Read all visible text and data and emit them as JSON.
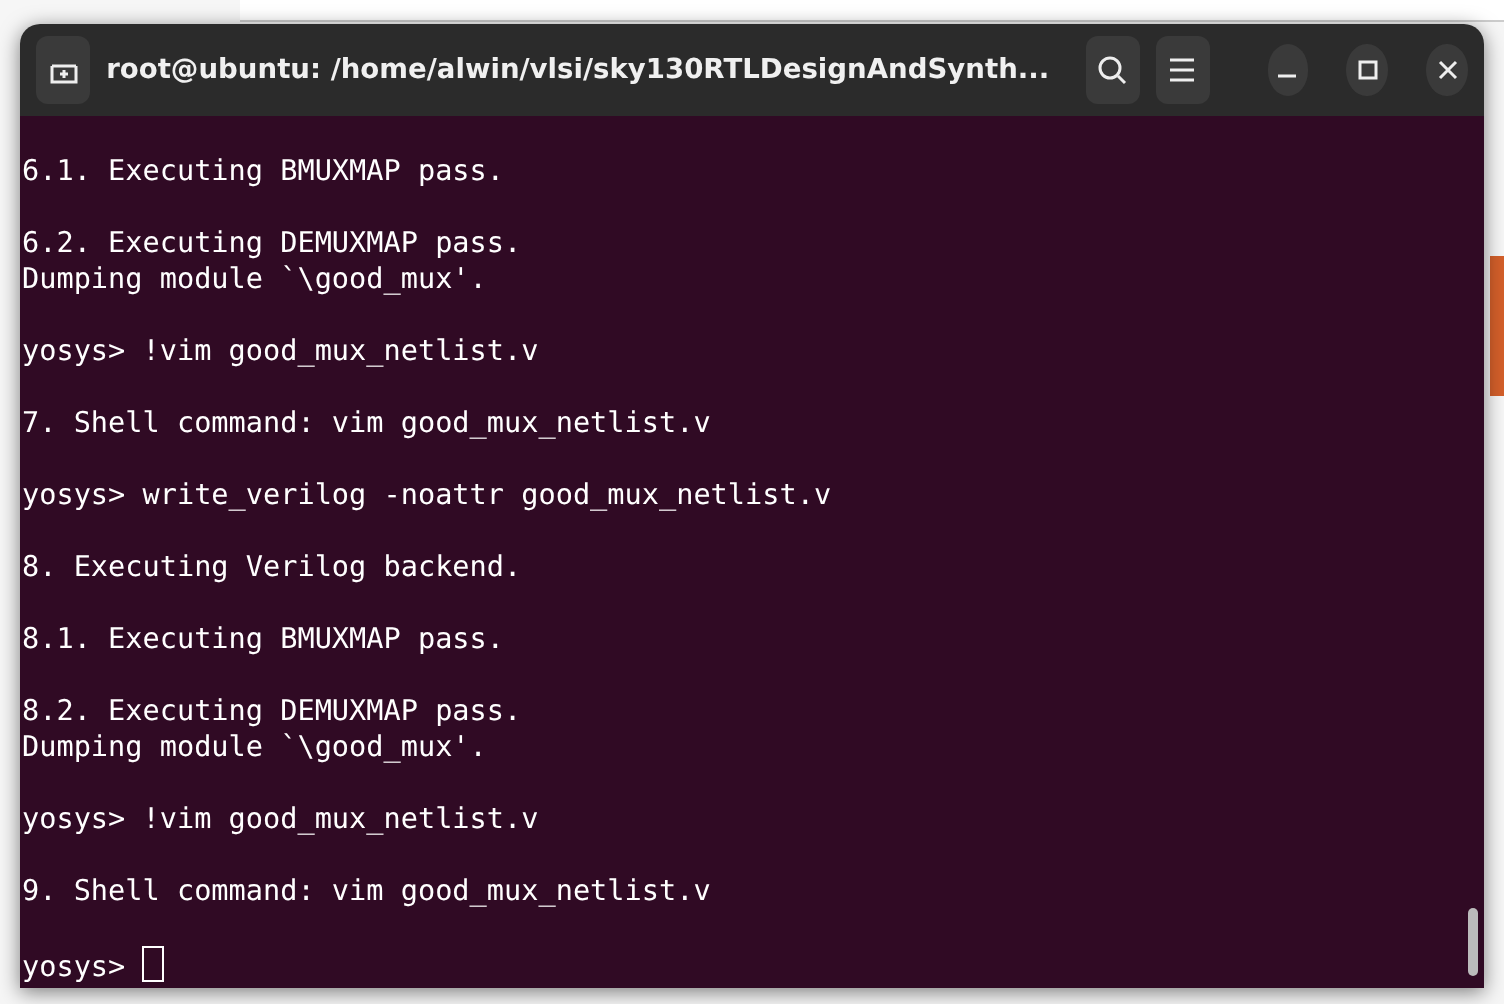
{
  "window": {
    "title": "root@ubuntu: /home/alwin/vlsi/sky130RTLDesignAndSynth..."
  },
  "terminal": {
    "blocks": [
      [
        "6.1. Executing BMUXMAP pass."
      ],
      [
        "6.2. Executing DEMUXMAP pass.",
        "Dumping module `\\good_mux'."
      ],
      [
        "yosys> !vim good_mux_netlist.v"
      ],
      [
        "7. Shell command: vim good_mux_netlist.v"
      ],
      [
        "yosys> write_verilog -noattr good_mux_netlist.v"
      ],
      [
        "8. Executing Verilog backend."
      ],
      [
        "8.1. Executing BMUXMAP pass."
      ],
      [
        "8.2. Executing DEMUXMAP pass.",
        "Dumping module `\\good_mux'."
      ],
      [
        "yosys> !vim good_mux_netlist.v"
      ],
      [
        "9. Shell command: vim good_mux_netlist.v"
      ]
    ],
    "prompt": {
      "text": "yosys>",
      "cursor": true
    }
  }
}
